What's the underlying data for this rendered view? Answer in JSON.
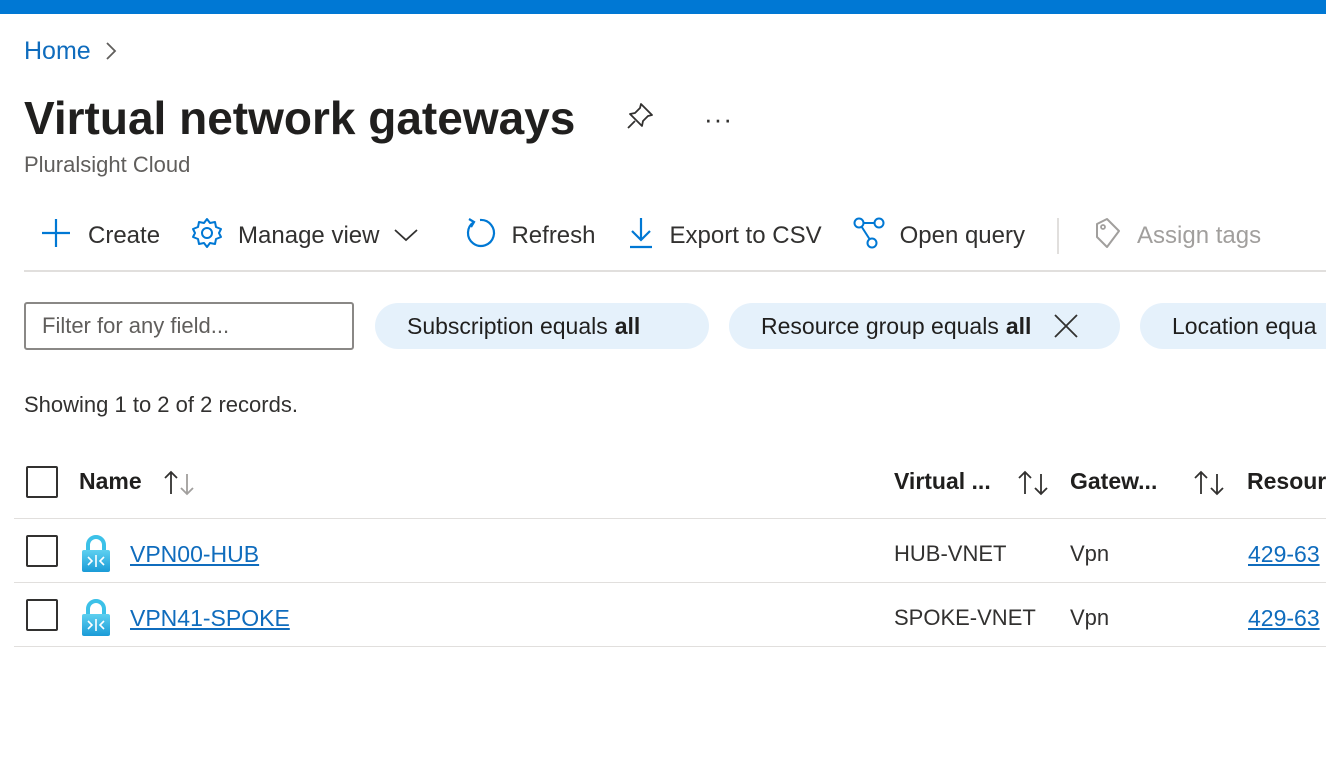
{
  "breadcrumb": {
    "home": "Home"
  },
  "header": {
    "title": "Virtual network gateways",
    "subtitle": "Pluralsight Cloud",
    "more": "···"
  },
  "toolbar": {
    "create": "Create",
    "manage_view": "Manage view",
    "refresh": "Refresh",
    "export_csv": "Export to CSV",
    "open_query": "Open query",
    "assign_tags": "Assign tags"
  },
  "filters": {
    "search_placeholder": "Filter for any field...",
    "pills": [
      {
        "label": "Subscription equals",
        "value": "all"
      },
      {
        "label": "Resource group equals",
        "value": "all"
      },
      {
        "label": "Location equa",
        "value": ""
      }
    ]
  },
  "records_text": "Showing 1 to 2 of 2 records.",
  "table": {
    "columns": [
      "Name",
      "Virtual ...",
      "Gatew...",
      "Resour"
    ],
    "rows": [
      {
        "name": "VPN00-HUB",
        "virtual_network": "HUB-VNET",
        "gateway_type": "Vpn",
        "resource": "429-63"
      },
      {
        "name": "VPN41-SPOKE",
        "virtual_network": "SPOKE-VNET",
        "gateway_type": "Vpn",
        "resource": "429-63"
      }
    ]
  },
  "colors": {
    "accent": "#0078d4",
    "link": "#0f6cbd",
    "pill_bg": "#e5f1fb"
  }
}
